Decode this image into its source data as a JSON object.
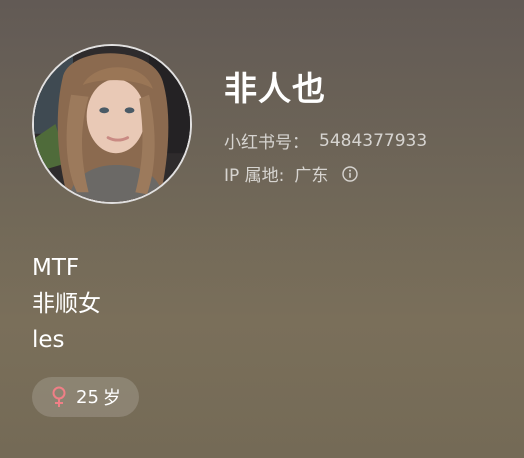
{
  "profile": {
    "nickname": "非人也",
    "id_label": "小红书号：",
    "id_value": "5484377933",
    "ip_label": "IP 属地:",
    "ip_value": "广东",
    "bio_lines": [
      "MTF",
      "非顺女",
      "les"
    ],
    "age_value": "25",
    "age_unit": "岁"
  },
  "icons": {
    "info": "info-circle-icon",
    "gender": "female-symbol-icon"
  },
  "colors": {
    "female_symbol": "#f07f86",
    "text_primary": "#ffffff",
    "text_secondary": "#d6d0c8"
  }
}
